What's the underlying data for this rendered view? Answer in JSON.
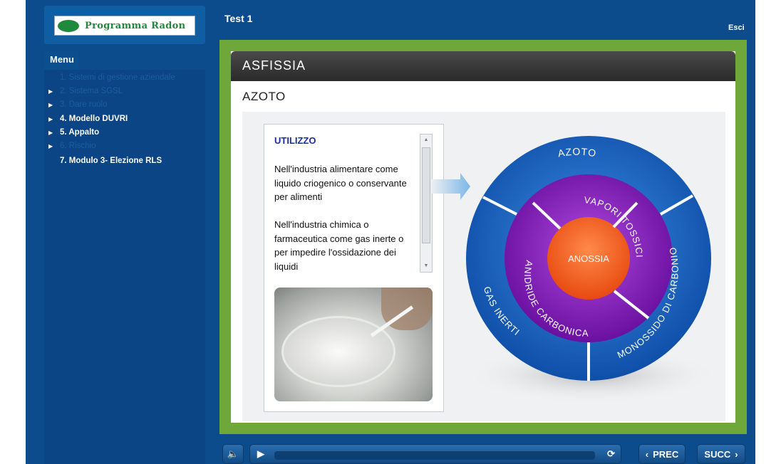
{
  "header": {
    "logo_text": "Programma Radon",
    "title": "Test 1",
    "exit_label": "Esci"
  },
  "menu": {
    "tab_label": "Menu",
    "items": [
      {
        "label": "1. Sistemi di gestione aziendale",
        "expandable": false,
        "dim": true
      },
      {
        "label": "2. Sistema SGSL",
        "expandable": true,
        "dim": true
      },
      {
        "label": "3. Dare ruolo",
        "expandable": true,
        "dim": true
      },
      {
        "label": "4. Modello DUVRI",
        "expandable": true,
        "dim": false
      },
      {
        "label": "5. Appalto",
        "expandable": true,
        "dim": false
      },
      {
        "label": "6. Rischio",
        "expandable": true,
        "dim": true
      },
      {
        "label": "7. Modulo 3- Elezione RLS",
        "expandable": false,
        "dim": false
      }
    ]
  },
  "slide": {
    "header": "ASFISSIA",
    "subtitle": "AZOTO",
    "textbox": {
      "title": "UTILIZZO",
      "paragraph1": "Nell'industria alimentare come liquido criogenico o conservante per alimenti",
      "paragraph2": "Nell'industria chimica o farmaceutica come gas inerte o per impedire l'ossidazione dei liquidi"
    },
    "diagram": {
      "center": "ANOSSIA",
      "middle": [
        "VAPORI TOSSICI",
        "ANIDRIDE CARBONICA"
      ],
      "outer": [
        "AZOTO",
        "MONOSSIDO DI CARBONIO",
        "GAS INERTI"
      ]
    }
  },
  "controls": {
    "prev_label": "PREC",
    "next_label": "SUCC"
  },
  "colors": {
    "stage_green": "#6fa83a",
    "panel_blue": "#0d4c8c",
    "outer_ring": "#1f6fd0",
    "middle_ring": "#8a1fb8",
    "center": "#f2601f"
  }
}
